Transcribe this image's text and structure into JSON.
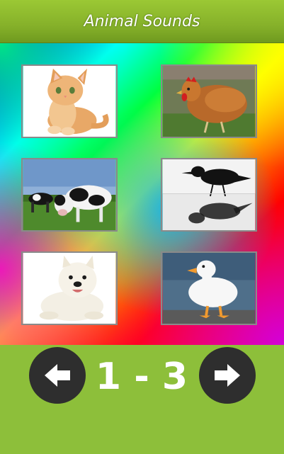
{
  "app": {
    "title": "Animal Sounds"
  },
  "grid": {
    "items": [
      {
        "animal": "cat",
        "icon": "cat-image"
      },
      {
        "animal": "chicken",
        "icon": "chicken-image"
      },
      {
        "animal": "cow",
        "icon": "cow-image"
      },
      {
        "animal": "crow",
        "icon": "crow-image"
      },
      {
        "animal": "dog",
        "icon": "dog-image"
      },
      {
        "animal": "duck",
        "icon": "duck-image"
      }
    ]
  },
  "pager": {
    "label": "1 - 3",
    "prev_icon": "arrow-left-icon",
    "next_icon": "arrow-right-icon"
  },
  "colors": {
    "title_bar": "#86b12a",
    "nav_panel": "#8dbf3a",
    "button": "#2e2e2e",
    "text": "#ffffff"
  }
}
